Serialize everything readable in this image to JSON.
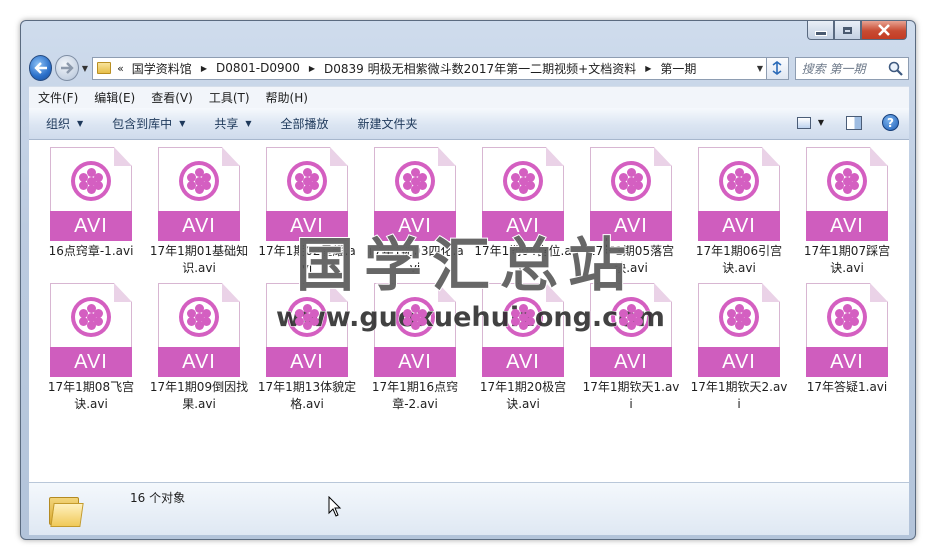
{
  "window": {
    "caption_buttons": [
      "minimize",
      "maximize",
      "close"
    ]
  },
  "address": {
    "chevron": "«",
    "breadcrumbs": [
      "国学资料馆",
      "D0801-D0900",
      "D0839 明极无相紫微斗数2017年第一二期视频+文档资料",
      "第一期"
    ]
  },
  "search": {
    "placeholder": "搜索 第一期"
  },
  "menu": {
    "items": [
      "文件(F)",
      "编辑(E)",
      "查看(V)",
      "工具(T)",
      "帮助(H)"
    ]
  },
  "commands": {
    "organize": "组织",
    "include_in_library": "包含到库中",
    "share": "共享",
    "play_all": "全部播放",
    "new_folder": "新建文件夹"
  },
  "files": [
    {
      "name": "16点窍章-1.avi",
      "badge": "AVI"
    },
    {
      "name": "17年1期01基础知识.avi",
      "badge": "AVI"
    },
    {
      "name": "17年1期02星耀.avi",
      "badge": "AVI"
    },
    {
      "name": "17年1期03四化.avi",
      "badge": "AVI"
    },
    {
      "name": "17年1期04宫位.avi",
      "badge": "AVI"
    },
    {
      "name": "17年1期05落宫诀.avi",
      "badge": "AVI"
    },
    {
      "name": "17年1期06引宫诀.avi",
      "badge": "AVI"
    },
    {
      "name": "17年1期07踩宫诀.avi",
      "badge": "AVI"
    },
    {
      "name": "17年1期08飞宫诀.avi",
      "badge": "AVI"
    },
    {
      "name": "17年1期09倒因找果.avi",
      "badge": "AVI"
    },
    {
      "name": "17年1期13体貌定格.avi",
      "badge": "AVI"
    },
    {
      "name": "17年1期16点窍章-2.avi",
      "badge": "AVI"
    },
    {
      "name": "17年1期20极宫诀.avi",
      "badge": "AVI"
    },
    {
      "name": "17年1期钦天1.avi",
      "badge": "AVI"
    },
    {
      "name": "17年1期钦天2.avi",
      "badge": "AVI"
    },
    {
      "name": "17年答疑1.avi",
      "badge": "AVI"
    }
  ],
  "status": {
    "count_text": "16 个对象"
  },
  "watermark": {
    "title": "国学汇总站",
    "url": "www.guoxuehuizong.com"
  },
  "colors": {
    "avi_accent": "#cf5dbe",
    "close_button": "#c84b32"
  },
  "icons": {
    "back": "back-arrow-icon",
    "forward": "forward-arrow-icon",
    "refresh": "refresh-icon",
    "search": "search-icon",
    "help": "help-icon",
    "file": "avi-video-file-icon"
  }
}
